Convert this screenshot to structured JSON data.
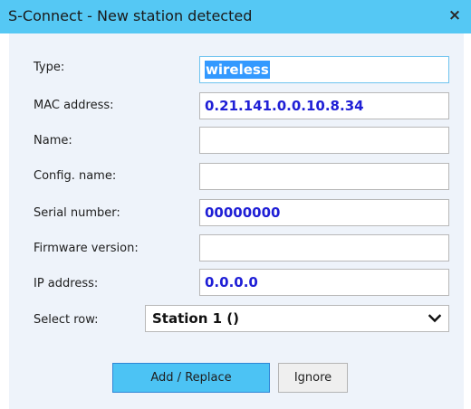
{
  "window": {
    "title": "S-Connect - New station detected",
    "close_glyph": "×"
  },
  "form": {
    "type": {
      "label": "Type:",
      "value": "wireless"
    },
    "mac": {
      "label": "MAC address:",
      "value": "0.21.141.0.0.10.8.34"
    },
    "name": {
      "label": "Name:",
      "value": ""
    },
    "config_name": {
      "label": "Config. name:",
      "value": ""
    },
    "serial": {
      "label": "Serial number:",
      "value": "00000000"
    },
    "firmware": {
      "label": "Firmware version:",
      "value": ""
    },
    "ip": {
      "label": "IP address:",
      "value": "0.0.0.0"
    },
    "select_row": {
      "label": "Select row:",
      "value": "Station 1 ()"
    }
  },
  "buttons": {
    "add_replace": "Add / Replace",
    "ignore": "Ignore"
  },
  "icons": {
    "close": "close-icon",
    "dropdown": "chevron-down-icon"
  },
  "colors": {
    "titlebar": "#55c8f4",
    "value_text": "#1f1fd6",
    "selection": "#3399ff",
    "primary_button": "#4cc3f4"
  }
}
